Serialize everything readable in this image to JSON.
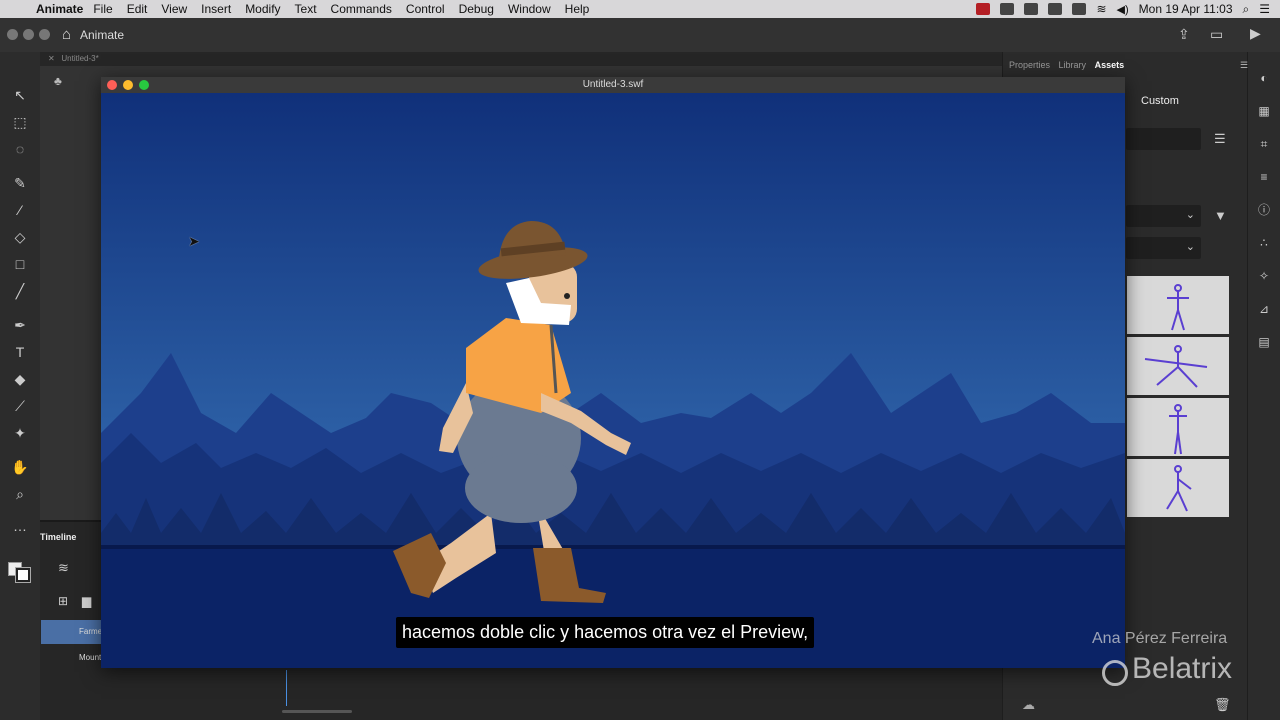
{
  "menubar": {
    "app_name": "Animate",
    "items": [
      "File",
      "Edit",
      "View",
      "Insert",
      "Modify",
      "Text",
      "Commands",
      "Control",
      "Debug",
      "Window",
      "Help"
    ],
    "clock": "Mon 19 Apr  11:03"
  },
  "app": {
    "home_tab": "Animate",
    "doc_tab": "Untitled-3*"
  },
  "timeline": {
    "title": "Timeline",
    "layers": [
      "Farmer",
      "Mountains"
    ]
  },
  "right_panel": {
    "tabs": [
      "Properties",
      "Library",
      "Assets"
    ],
    "active_tab": "Assets",
    "custom_label": "Custom"
  },
  "swf_window": {
    "title": "Untitled-3.swf"
  },
  "subtitle": "hacemos doble clic y hacemos otra vez el Preview,",
  "watermark": {
    "author": "Ana Pérez Ferreira",
    "brand": "Belatrix"
  },
  "colors": {
    "sky_top": "#10307a",
    "sky_bottom": "#3f7fc2",
    "mountains_far": "#1d3f8c",
    "ground": "#0b2366"
  }
}
